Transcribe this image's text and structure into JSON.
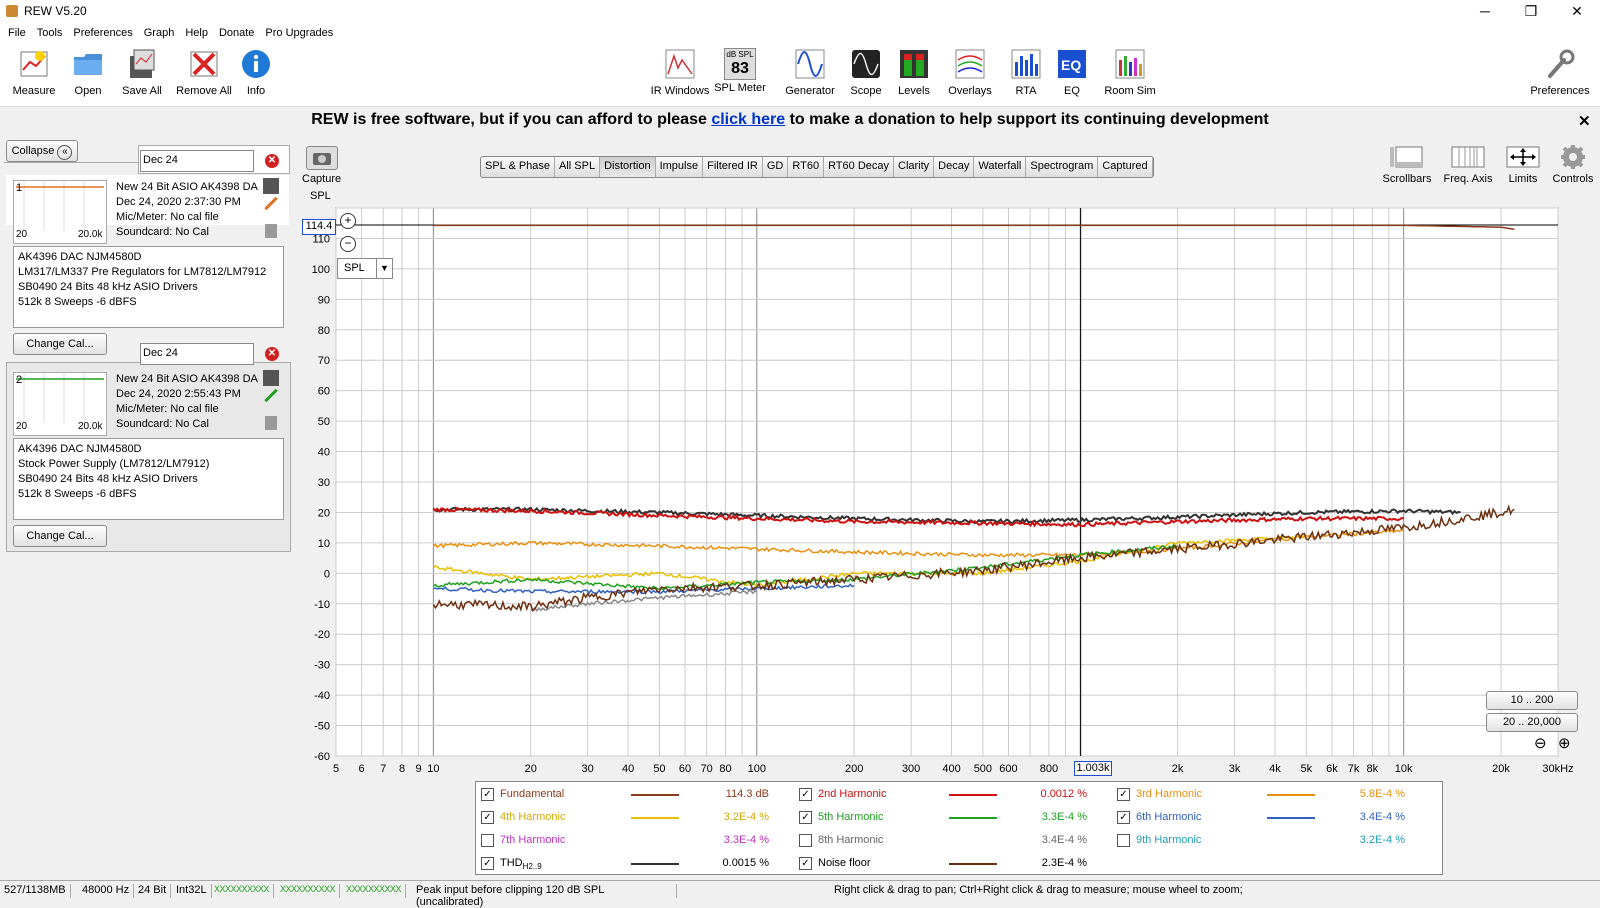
{
  "window": {
    "title": "REW V5.20",
    "minimize": "─",
    "maximize": "❐",
    "close": "✕"
  },
  "menu": [
    "File",
    "Tools",
    "Preferences",
    "Graph",
    "Help",
    "Donate",
    "Pro Upgrades"
  ],
  "toolbar": {
    "left": [
      {
        "label": "Measure",
        "icon": "measure-icon"
      },
      {
        "label": "Open",
        "icon": "folder-icon"
      },
      {
        "label": "Save All",
        "icon": "save-icon"
      },
      {
        "label": "Remove All",
        "icon": "remove-icon"
      },
      {
        "label": "Info",
        "icon": "info-icon"
      }
    ],
    "center": [
      {
        "label": "IR Windows",
        "icon": "ir-windows-icon"
      },
      {
        "label": "SPL Meter",
        "icon": "spl-meter-icon",
        "meter_unit": "dB SPL",
        "meter_value": "83"
      },
      {
        "label": "Generator",
        "icon": "generator-icon"
      },
      {
        "label": "Scope",
        "icon": "scope-icon"
      },
      {
        "label": "Levels",
        "icon": "levels-icon"
      },
      {
        "label": "Overlays",
        "icon": "overlays-icon"
      },
      {
        "label": "RTA",
        "icon": "rta-icon"
      },
      {
        "label": "EQ",
        "icon": "eq-icon"
      },
      {
        "label": "Room Sim",
        "icon": "room-sim-icon"
      }
    ],
    "preferences": {
      "label": "Preferences",
      "icon": "wrench-icon"
    }
  },
  "banner": {
    "before": "REW is free software, but if you can afford to please ",
    "link": "click here",
    "after": " to make a donation to help support its continuing development",
    "close": "✕"
  },
  "left_panel": {
    "collapse_label": "Collapse",
    "measurements": [
      {
        "index": "1",
        "name_field": "Dec 24",
        "title": "New 24 Bit ASIO AK4398 DA",
        "date": "Dec 24, 2020 2:37:30 PM",
        "mic": "Mic/Meter: No cal file",
        "soundcard": "Soundcard: No Cal",
        "thumb_from": "20",
        "thumb_to": "20.0k",
        "trace_color": "#e07020",
        "notes": [
          "AK4396 DAC NJM4580D",
          "LM317/LM337 Pre Regulators for LM7812/LM7912",
          "SB0490 24 Bits 48 kHz ASIO Drivers",
          "512k 8 Sweeps -6 dBFS"
        ],
        "change_cal": "Change Cal..."
      },
      {
        "index": "2",
        "name_field": "Dec 24",
        "title": "New 24 Bit ASIO AK4398 DA",
        "date": "Dec 24, 2020 2:55:43 PM",
        "mic": "Mic/Meter: No cal file",
        "soundcard": "Soundcard: No Cal",
        "thumb_from": "20",
        "thumb_to": "20.0k",
        "trace_color": "#20a020",
        "notes": [
          "AK4396 DAC NJM4580D",
          "Stock Power Supply (LM7812/LM7912)",
          "SB0490 24 Bits 48 kHz ASIO Drivers",
          "512k 8 Sweeps -6 dBFS"
        ],
        "change_cal": "Change Cal..."
      }
    ]
  },
  "tabs": [
    "SPL & Phase",
    "All SPL",
    "Distortion",
    "Impulse",
    "Filtered IR",
    "GD",
    "RT60",
    "RT60 Decay",
    "Clarity",
    "Decay",
    "Waterfall",
    "Spectrogram",
    "Captured"
  ],
  "selected_tab": "Distortion",
  "capture_label": "Capture",
  "graph_controls": [
    {
      "label": "Scrollbars",
      "icon": "scrollbars-icon"
    },
    {
      "label": "Freq. Axis",
      "icon": "freq-axis-icon"
    },
    {
      "label": "Limits",
      "icon": "limits-icon"
    },
    {
      "label": "Controls",
      "icon": "gear-icon"
    }
  ],
  "graph": {
    "y_axis_unit": "SPL",
    "y_cursor_value": "114.4",
    "x_cursor_value": "1.003k",
    "unit_selector": "SPL",
    "range_buttons": [
      "10 .. 200",
      "20 .. 20,000"
    ],
    "zoom_out": "⊖",
    "zoom_in": "⊕"
  },
  "chart_data": {
    "type": "line",
    "x_scale": "log",
    "xlim": [
      5,
      30000
    ],
    "ylim": [
      -60,
      120
    ],
    "xticks": [
      "5",
      "6",
      "7",
      "8",
      "9",
      "10",
      "20",
      "30",
      "40",
      "50",
      "60",
      "70",
      "80",
      "100",
      "200",
      "300",
      "400",
      "500",
      "600",
      "800",
      "2k",
      "3k",
      "4k",
      "5k",
      "6k",
      "7k",
      "8k",
      "10k",
      "20k",
      "30kHz"
    ],
    "yticks": [
      "110",
      "100",
      "90",
      "80",
      "70",
      "60",
      "50",
      "40",
      "30",
      "20",
      "10",
      "0",
      "-10",
      "-20",
      "-30",
      "-40",
      "-50",
      "-60"
    ],
    "grid": true,
    "cursor_x": 1003,
    "series": [
      {
        "name": "Fundamental",
        "color": "#8b3a1a",
        "x": [
          10,
          100,
          1000,
          10000,
          20000,
          22000
        ],
        "y": [
          114.3,
          114.3,
          114.3,
          114.3,
          113.7,
          113.0
        ]
      },
      {
        "name": "THD",
        "color": "#333333",
        "x": [
          10,
          20,
          50,
          100,
          200,
          500,
          1000,
          2000,
          5000,
          10000,
          15000
        ],
        "y": [
          21,
          21,
          20,
          19,
          18,
          17,
          17.5,
          18.5,
          20,
          20.5,
          20
        ]
      },
      {
        "name": "2nd Harmonic",
        "color": "#cc1111",
        "x": [
          10,
          20,
          50,
          100,
          200,
          500,
          1000,
          2000,
          5000,
          10000
        ],
        "y": [
          21,
          20.5,
          19,
          18,
          17,
          16.5,
          16,
          17,
          18,
          18
        ]
      },
      {
        "name": "3rd Harmonic",
        "color": "#e89010",
        "x": [
          10,
          20,
          50,
          100,
          200,
          500,
          1000,
          2000,
          5000,
          10000
        ],
        "y": [
          9,
          10,
          9,
          8,
          7,
          6,
          6,
          8,
          12,
          14
        ]
      },
      {
        "name": "4th Harmonic",
        "color": "#e8c000",
        "x": [
          10,
          20,
          50,
          100,
          200,
          500,
          1000,
          2000,
          5000
        ],
        "y": [
          2,
          -2,
          0,
          -4,
          0,
          0,
          4,
          10,
          12
        ]
      },
      {
        "name": "5th Harmonic",
        "color": "#20a020",
        "x": [
          10,
          20,
          50,
          100,
          200,
          500,
          1000,
          2000
        ],
        "y": [
          -4,
          -2,
          -5,
          -3,
          -2,
          2,
          6,
          9
        ]
      },
      {
        "name": "6th Harmonic",
        "color": "#3060c0",
        "x": [
          10,
          20,
          50,
          100,
          200
        ],
        "y": [
          -5,
          -6,
          -6,
          -5,
          -4
        ]
      },
      {
        "name": "7th Harmonic",
        "color": "#c030c0",
        "x": [],
        "y": []
      },
      {
        "name": "8th Harmonic",
        "color": "#888888",
        "x": [
          20,
          30,
          50,
          100
        ],
        "y": [
          -12,
          -10,
          -8,
          -6
        ]
      },
      {
        "name": "9th Harmonic",
        "color": "#20a0b0",
        "x": [],
        "y": []
      },
      {
        "name": "Noise floor",
        "color": "#6b3010",
        "x": [
          10,
          20,
          30,
          50,
          100,
          200,
          500,
          1000,
          2000,
          5000,
          10000,
          20000,
          22000
        ],
        "y": [
          -10,
          -11,
          -8,
          -5,
          -4,
          -2,
          1,
          5,
          8,
          12,
          15,
          20,
          21
        ]
      }
    ]
  },
  "legend": [
    {
      "checked": true,
      "name": "Fundamental",
      "value": "114.3 dB",
      "color": "#8b3a1a",
      "text_color": "#8b3a1a"
    },
    {
      "checked": true,
      "name": "2nd Harmonic",
      "value": "0.0012 %",
      "color": "#cc1111",
      "text_color": "#cc1111"
    },
    {
      "checked": true,
      "name": "3rd Harmonic",
      "value": "5.8E-4 %",
      "color": "#e89010",
      "text_color": "#e89010"
    },
    {
      "checked": true,
      "name": "4th Harmonic",
      "value": "3.2E-4 %",
      "color": "#e8c000",
      "text_color": "#d0a800"
    },
    {
      "checked": true,
      "name": "5th Harmonic",
      "value": "3.3E-4 %",
      "color": "#20a020",
      "text_color": "#20a020"
    },
    {
      "checked": true,
      "name": "6th Harmonic",
      "value": "3.4E-4 %",
      "color": "#3060c0",
      "text_color": "#3060c0"
    },
    {
      "checked": false,
      "name": "7th Harmonic",
      "value": "3.3E-4 %",
      "color": "",
      "text_color": "#c030c0"
    },
    {
      "checked": false,
      "name": "8th Harmonic",
      "value": "3.4E-4 %",
      "color": "",
      "text_color": "#666666"
    },
    {
      "checked": false,
      "name": "9th Harmonic",
      "value": "3.2E-4 %",
      "color": "",
      "text_color": "#20a0b0"
    },
    {
      "checked": true,
      "name": "THD",
      "name_sub": "H2..9",
      "value": "0.0015 %",
      "color": "#333333",
      "text_color": "#000000"
    },
    {
      "checked": true,
      "name": "Noise floor",
      "value": "2.3E-4 %",
      "color": "#6b3010",
      "text_color": "#000000"
    }
  ],
  "status": {
    "memory": "527/1138MB",
    "rate": "48000 Hz",
    "bits": "24 Bit",
    "format": "Int32L",
    "meters": [
      "XXXXXXXXXX",
      "XXXXXXXXXX",
      "XXXXXXXXXX"
    ],
    "peak": "Peak input before clipping 120 dB SPL (uncalibrated)",
    "hint": "Right click & drag to pan; Ctrl+Right click & drag to measure; mouse wheel to zoom;"
  }
}
